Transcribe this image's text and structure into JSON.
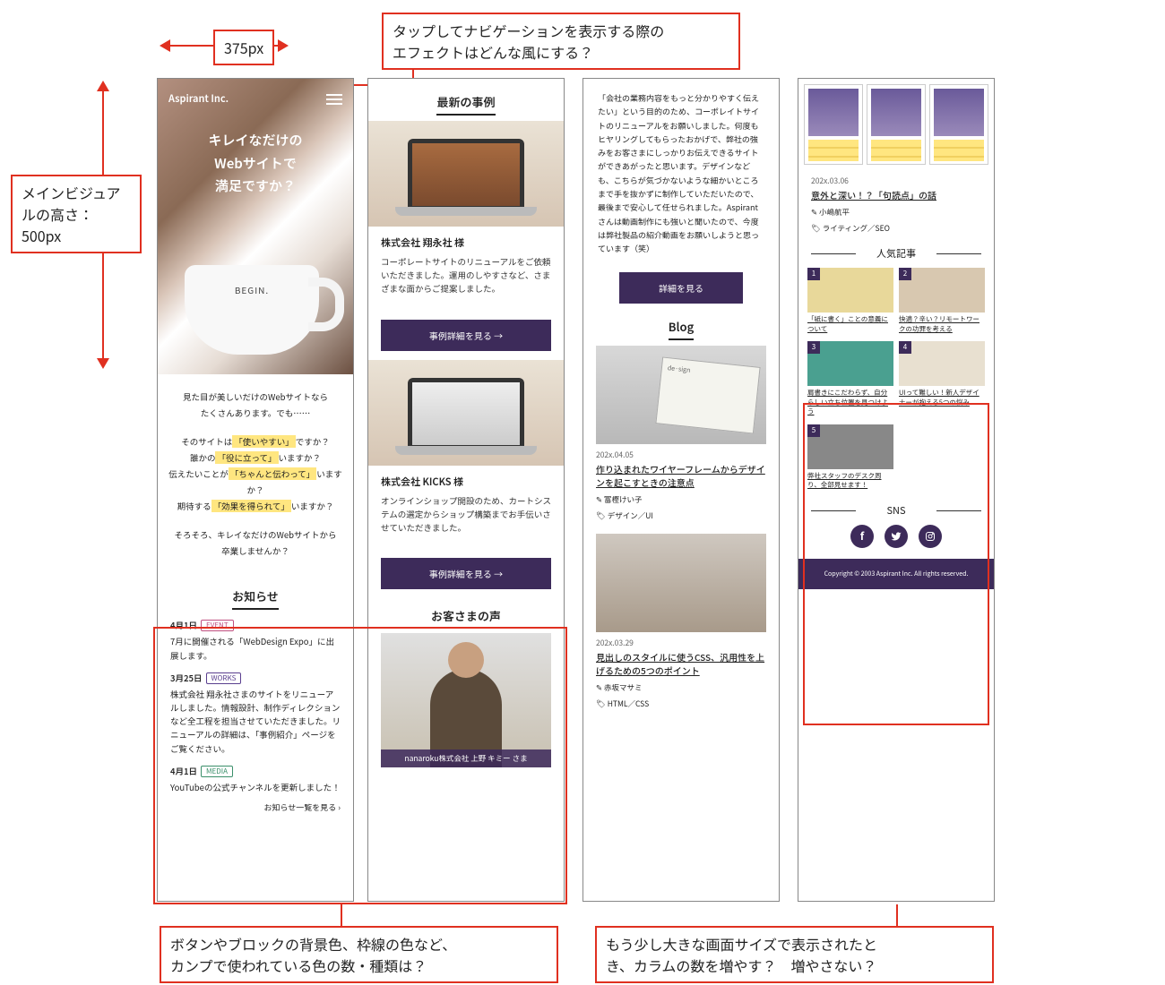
{
  "annotations": {
    "width_label": "375px",
    "nav_effect": "タップしてナビゲーションを表示する際の\nエフェクトはどんな風にする？",
    "hero_height": "メインビジュアルの高さ：500px",
    "colors_q": "ボタンやブロックの背景色、枠線の色など、\nカンプで使われている色の数・種類は？",
    "columns_q": "もう少し大きな画面サイズで表示されたと\nき、カラムの数を増やす？　増やさない？"
  },
  "hero": {
    "logo": "Aspirant Inc.",
    "headline_l1": "キレイなだけの",
    "headline_l2": "Webサイトで",
    "headline_l3": "満足ですか？",
    "cup_label": "BEGIN."
  },
  "intro": {
    "p1a": "見た目が美しいだけのWebサイトなら",
    "p1b": "たくさんあります。でも……",
    "q1_pre": "そのサイトは",
    "q1_hl": "「使いやすい」",
    "q1_post": "ですか？",
    "q2_pre": "誰かの",
    "q2_hl": "「役に立って」",
    "q2_post": "いますか？",
    "q3_pre": "伝えたいことが",
    "q3_hl": "「ちゃんと伝わって」",
    "q3_post": "いますか？",
    "q4_pre": "期待する",
    "q4_hl": "「効果を得られて」",
    "q4_post": "いますか？",
    "p2a": "そろそろ、キレイなだけのWebサイトから",
    "p2b": "卒業しませんか？"
  },
  "news": {
    "heading": "お知らせ",
    "items": [
      {
        "date": "4月1日",
        "badge": "EVENT",
        "badge_class": "b-event",
        "body": "7月に開催される「WebDesign Expo」に出展します。"
      },
      {
        "date": "3月25日",
        "badge": "WORKS",
        "badge_class": "b-works",
        "body": "株式会社 翔永社さまのサイトをリニューアルしました。情報設計、制作ディレクションなど全工程を担当させていただきました。リニューアルの詳細は、「事例紹介」ページをご覧ください。"
      },
      {
        "date": "4月1日",
        "badge": "MEDIA",
        "badge_class": "b-media",
        "body": "YouTubeの公式チャンネルを更新しました！"
      }
    ],
    "more": "お知らせ一覧を見る ›"
  },
  "cases": {
    "heading": "最新の事例",
    "btn": "事例詳細を見る →",
    "items": [
      {
        "title": "株式会社 翔永社 様",
        "desc": "コーポレートサイトのリニューアルをご依頼いただきました。運用のしやすさなど、さまざまな面からご提案しました。"
      },
      {
        "title": "株式会社 KICKS 様",
        "desc": "オンラインショップ開設のため、カートシステムの選定からショップ構築までお手伝いさせていただきました。"
      }
    ]
  },
  "voice": {
    "heading": "お客さまの声",
    "caption": "nanaroku株式会社 上野 キミー さま"
  },
  "testimonial": {
    "body": "「会社の業務内容をもっと分かりやすく伝えたい」という目的のため、コーポレイトサイトのリニューアルをお願いしました。何度もヒヤリングしてもらったおかげで、弊社の強みをお客さまにしっかりお伝えできるサイトができあがったと思います。デザインなども、こちらが気づかないような細かいところまで手を抜かずに制作していただいたので、最後まで安心して任せられました。Aspirantさんは動画制作にも強いと聞いたので、今度は弊社製品の紹介動画をお願いしようと思っています（笑）",
    "btn": "詳細を見る"
  },
  "blog": {
    "heading": "Blog",
    "items": [
      {
        "date": "202x.04.05",
        "title": "作り込まれたワイヤーフレームからデザインを起こすときの注意点",
        "author": "富樫けい子",
        "tag": "デザイン／UI",
        "notebook": "de·sign"
      },
      {
        "date": "202x.03.29",
        "title": "見出しのスタイルに使うCSS、汎用性を上げるための5つのポイント",
        "author": "赤坂マサミ",
        "tag": "HTML／CSS"
      }
    ]
  },
  "blog4": {
    "date": "202x.03.06",
    "title": "意外と深い！？「句読点」の話",
    "author": "小嶋航平",
    "tag": "ライティング／SEO"
  },
  "popular": {
    "heading": "人気記事",
    "items": [
      {
        "n": "1",
        "title": "「紙に書く」ことの意義について"
      },
      {
        "n": "2",
        "title": "快適？辛い？リモートワークの功罪を考える"
      },
      {
        "n": "3",
        "title": "肩書きにこだわらず、自分らしい立ち位置を見つけよう"
      },
      {
        "n": "4",
        "title": "UIって難しい！新人デザイナーが抱える5つの悩み"
      },
      {
        "n": "5",
        "title": "弊社スタッフのデスク周り、全部見せます！"
      }
    ]
  },
  "sns": {
    "heading": "SNS",
    "icons": [
      "f",
      "t",
      "ig"
    ]
  },
  "footer": "Copyright © 2003 Aspirant Inc. All rights reserved."
}
